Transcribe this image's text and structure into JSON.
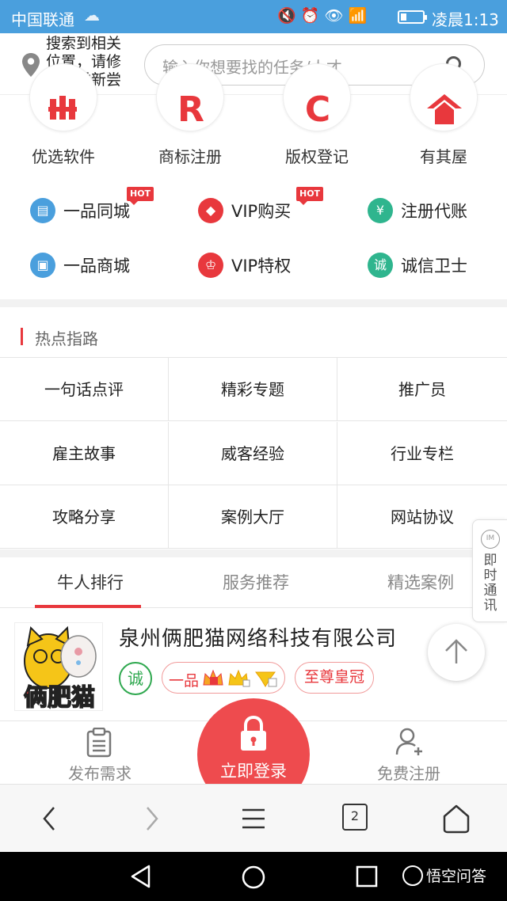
{
  "status_bar": {
    "carrier": "中国联通",
    "time": "凌晨1:13",
    "network": "4G"
  },
  "header": {
    "location_text": "搜索到相关位置，请修改后重新尝试",
    "search_placeholder": "输入你想要找的任务/人才"
  },
  "top_services": [
    {
      "label": "优选软件",
      "icon": "youxuan-logo-icon"
    },
    {
      "label": "商标注册",
      "icon": "trademark-r-icon"
    },
    {
      "label": "版权登记",
      "icon": "copyright-c-icon"
    },
    {
      "label": "有其屋",
      "icon": "house-icon"
    }
  ],
  "quick_links": [
    {
      "label": "一品同城",
      "icon": "store-icon",
      "color": "#4a9fdd",
      "hot": true
    },
    {
      "label": "VIP购买",
      "icon": "diamond-icon",
      "color": "#e8383d",
      "hot": true
    },
    {
      "label": "注册代账",
      "icon": "yen-doc-icon",
      "color": "#2fb58e",
      "hot": false
    },
    {
      "label": "一品商城",
      "icon": "shopping-bag-icon",
      "color": "#4a9fdd",
      "hot": false
    },
    {
      "label": "VIP特权",
      "icon": "crown-badge-icon",
      "color": "#e8383d",
      "hot": false
    },
    {
      "label": "诚信卫士",
      "icon": "integrity-icon",
      "color": "#2fb58e",
      "hot": false
    }
  ],
  "hot_label": "HOT",
  "hot_guides": {
    "title": "热点指路",
    "items": [
      "一句话点评",
      "精彩专题",
      "推广员",
      "雇主故事",
      "威客经验",
      "行业专栏",
      "攻略分享",
      "案例大厅",
      "网站协议"
    ]
  },
  "tabs": {
    "items": [
      "牛人排行",
      "服务推荐",
      "精选案例"
    ],
    "active_index": 0
  },
  "company": {
    "name": "泉州俩肥猫网络科技有限公司",
    "logo_text": "俩肥猫",
    "badge_cheng": "诚",
    "badge_yipin": "一品",
    "badge_zhizun": "至尊皇冠"
  },
  "side_im": {
    "icon_text": "IM",
    "label": "即时通讯"
  },
  "bottom_bar": {
    "publish_label": "发布需求",
    "login_label": "立即登录",
    "register_label": "免费注册"
  },
  "browser": {
    "tab_count": "2"
  },
  "watermark": "悟空问答",
  "colors": {
    "brand_red": "#e8383d",
    "status_blue": "#4a9fdd",
    "green": "#2fa84f"
  }
}
